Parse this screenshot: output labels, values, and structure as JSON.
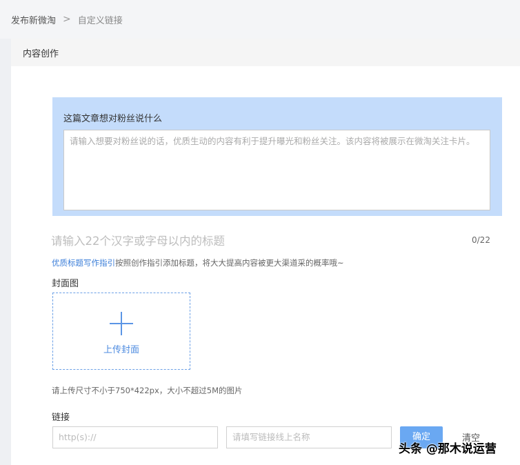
{
  "breadcrumb": {
    "parent": "发布新微淘",
    "separator": ">",
    "current": "自定义链接"
  },
  "panel": {
    "title": "内容创作"
  },
  "message": {
    "label": "这篇文章想对粉丝说什么",
    "placeholder": "请输入想要对粉丝说的话，优质生动的内容有利于提升曝光和粉丝关注。该内容将被展示在微淘关注卡片。"
  },
  "title_field": {
    "placeholder": "请输入22个汉字或字母以内的标题",
    "counter": "0/22"
  },
  "guide": {
    "link_text": "优质标题写作指引",
    "rest_text": "按照创作指引添加标题，将大大提高内容被更大渠道采的概率哦~"
  },
  "cover": {
    "label": "封面图",
    "upload_text": "上传封面",
    "size_hint": "请上传尺寸不小于750*422px，大小不超过5M的图片"
  },
  "link": {
    "label": "链接",
    "url_placeholder": "http(s)://",
    "name_placeholder": "请填写链接线上名称",
    "confirm_label": "确定",
    "clear_label": "清空"
  },
  "watermark": "头条 @那木说运营"
}
